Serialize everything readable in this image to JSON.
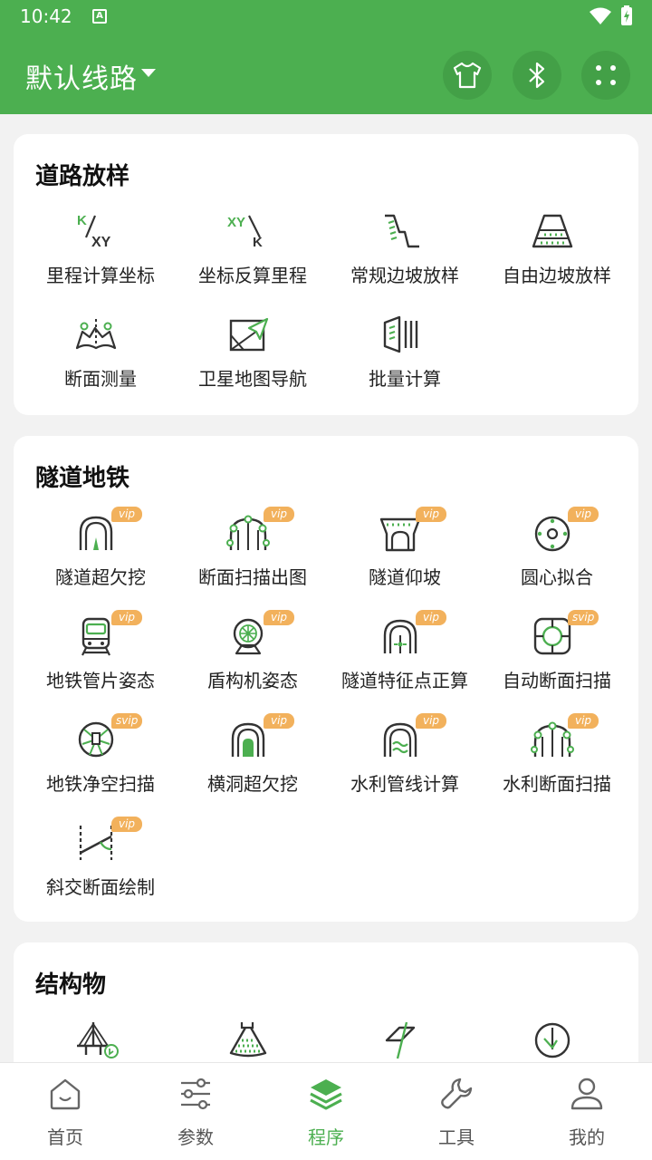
{
  "status_bar": {
    "time": "10:42",
    "notification_icon": "A"
  },
  "app_bar": {
    "title": "默认线路"
  },
  "sections": [
    {
      "title": "道路放样",
      "items": [
        {
          "label": "里程计算坐标",
          "icon": "k-to-xy-icon"
        },
        {
          "label": "坐标反算里程",
          "icon": "xy-to-k-icon"
        },
        {
          "label": "常规边坡放样",
          "icon": "slope-icon"
        },
        {
          "label": "自由边坡放样",
          "icon": "free-slope-icon"
        },
        {
          "label": "断面测量",
          "icon": "cross-section-icon"
        },
        {
          "label": "卫星地图导航",
          "icon": "map-nav-icon"
        },
        {
          "label": "批量计算",
          "icon": "batch-icon"
        }
      ]
    },
    {
      "title": "隧道地铁",
      "items": [
        {
          "label": "隧道超欠挖",
          "icon": "tunnel-icon",
          "badge": "vip"
        },
        {
          "label": "断面扫描出图",
          "icon": "section-scan-icon",
          "badge": "vip"
        },
        {
          "label": "隧道仰坡",
          "icon": "tunnel-slope-icon",
          "badge": "vip"
        },
        {
          "label": "圆心拟合",
          "icon": "circle-fit-icon",
          "badge": "vip"
        },
        {
          "label": "地铁管片姿态",
          "icon": "train-icon",
          "badge": "vip"
        },
        {
          "label": "盾构机姿态",
          "icon": "shield-machine-icon",
          "badge": "vip"
        },
        {
          "label": "隧道特征点正算",
          "icon": "tunnel-point-icon",
          "badge": "vip"
        },
        {
          "label": "自动断面扫描",
          "icon": "auto-scan-icon",
          "badge": "svip"
        },
        {
          "label": "地铁净空扫描",
          "icon": "clearance-scan-icon",
          "badge": "svip"
        },
        {
          "label": "横洞超欠挖",
          "icon": "cross-tunnel-icon",
          "badge": "vip"
        },
        {
          "label": "水利管线计算",
          "icon": "water-pipe-icon",
          "badge": "vip"
        },
        {
          "label": "水利断面扫描",
          "icon": "water-section-icon",
          "badge": "vip"
        },
        {
          "label": "斜交断面绘制",
          "icon": "skew-section-icon",
          "badge": "vip"
        }
      ]
    },
    {
      "title": "结构物",
      "items": [
        {
          "label": "",
          "icon": "bridge-icon"
        },
        {
          "label": "",
          "icon": "cone-icon"
        },
        {
          "label": "",
          "icon": "pier-icon"
        },
        {
          "label": "",
          "icon": "pile-icon"
        }
      ]
    }
  ],
  "bottom_nav": [
    {
      "label": "首页",
      "icon": "home-icon"
    },
    {
      "label": "参数",
      "icon": "sliders-icon"
    },
    {
      "label": "程序",
      "icon": "layers-icon",
      "active": true
    },
    {
      "label": "工具",
      "icon": "wrench-icon"
    },
    {
      "label": "我的",
      "icon": "user-icon"
    }
  ],
  "colors": {
    "primary": "#4caf50",
    "badge": "#f2b15c"
  }
}
